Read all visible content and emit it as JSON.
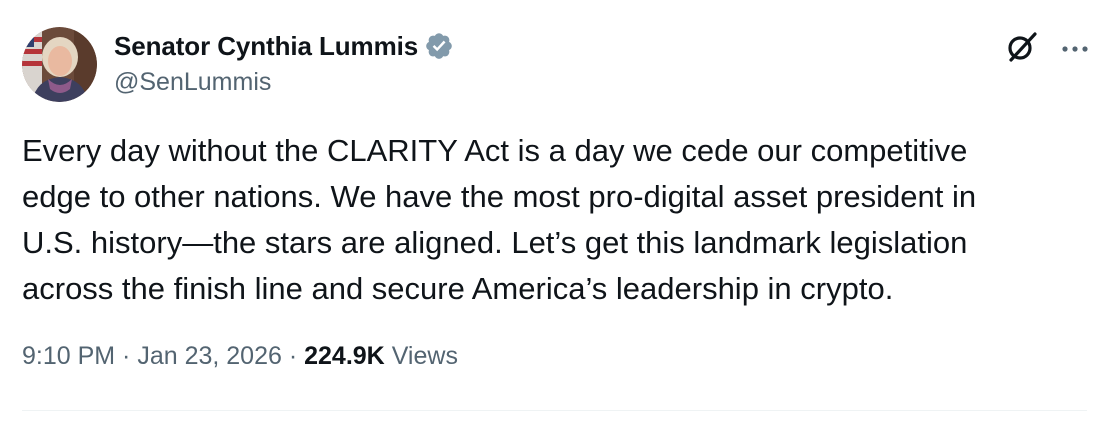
{
  "author": {
    "display_name": "Senator Cynthia Lummis",
    "handle": "@SenLummis",
    "verified_color": "#829aab"
  },
  "actions": {
    "grok_icon": "grok-icon",
    "more_icon": "more-icon"
  },
  "tweet": {
    "text": "Every day without the CLARITY Act is a day we cede our competitive\nedge to other nations. We have the most pro-digital asset president in\nU.S. history—the stars are aligned. Let’s get this landmark legislation\nacross the finish line and secure America’s leadership in crypto.",
    "time": "9:10 PM",
    "separator": " · ",
    "date": "Jan 23, 2026",
    "views_count": "224.9K",
    "views_label": "Views"
  },
  "colors": {
    "text_primary": "#0f1419",
    "text_secondary": "#536471",
    "divider": "#eff3f4"
  }
}
